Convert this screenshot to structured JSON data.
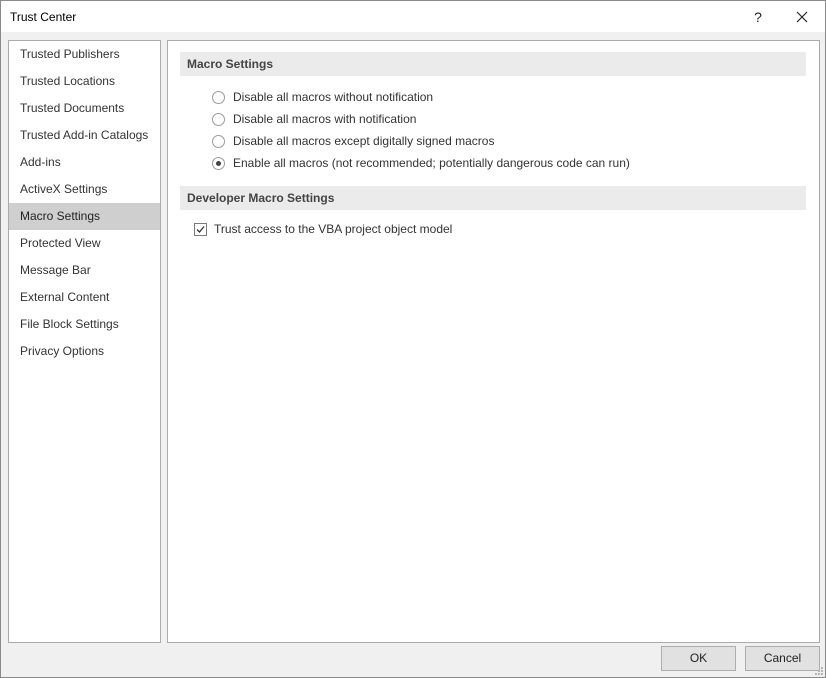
{
  "window": {
    "title": "Trust Center",
    "help_glyph": "?"
  },
  "nav": {
    "items": [
      {
        "label": "Trusted Publishers"
      },
      {
        "label": "Trusted Locations"
      },
      {
        "label": "Trusted Documents"
      },
      {
        "label": "Trusted Add-in Catalogs"
      },
      {
        "label": "Add-ins"
      },
      {
        "label": "ActiveX Settings"
      },
      {
        "label": "Macro Settings",
        "selected": true
      },
      {
        "label": "Protected View"
      },
      {
        "label": "Message Bar"
      },
      {
        "label": "External Content"
      },
      {
        "label": "File Block Settings"
      },
      {
        "label": "Privacy Options"
      }
    ]
  },
  "macro_settings": {
    "header": "Macro Settings",
    "options": [
      {
        "label": "Disable all macros without notification",
        "checked": false
      },
      {
        "label": "Disable all macros with notification",
        "checked": false
      },
      {
        "label": "Disable all macros except digitally signed macros",
        "checked": false
      },
      {
        "label": "Enable all macros (not recommended; potentially dangerous code can run)",
        "checked": true
      }
    ]
  },
  "developer_settings": {
    "header": "Developer Macro Settings",
    "vba_access_label": "Trust access to the VBA project object model",
    "vba_access_checked": true
  },
  "footer": {
    "ok_label": "OK",
    "cancel_label": "Cancel"
  },
  "icons": {
    "close": "close-icon",
    "check": "check-icon",
    "resize": "resize-grip-icon"
  }
}
